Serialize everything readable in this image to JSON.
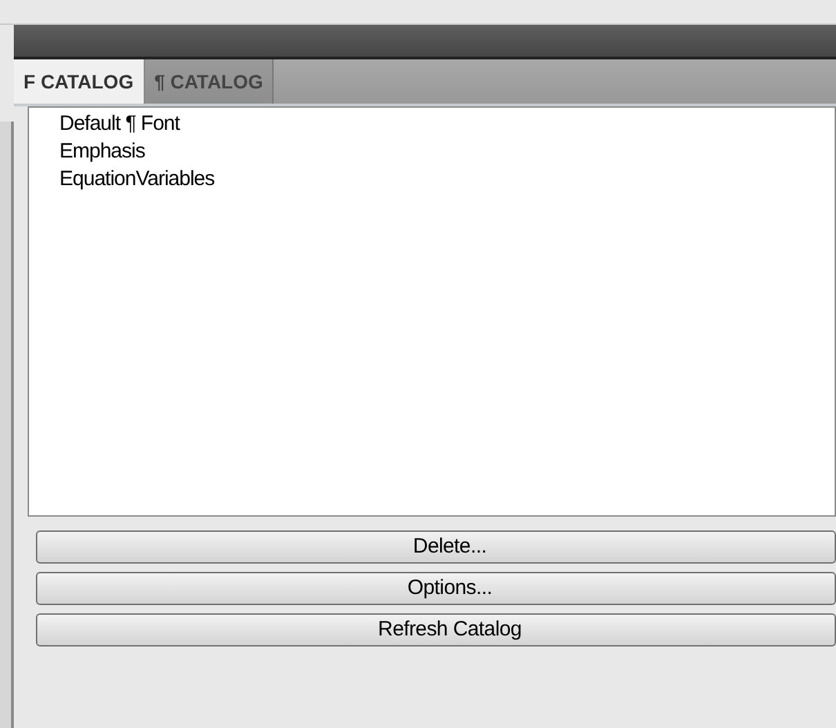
{
  "tabs": [
    {
      "label": "F CATALOG",
      "selected": true
    },
    {
      "label": "¶ CATALOG",
      "selected": false
    }
  ],
  "items": [
    "Default ¶ Font",
    "Emphasis",
    "EquationVariables"
  ],
  "buttons": [
    "Delete...",
    "Options...",
    "Refresh Catalog"
  ]
}
